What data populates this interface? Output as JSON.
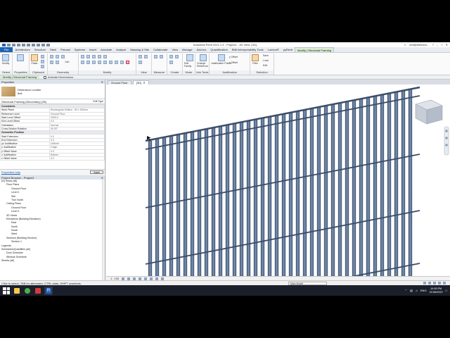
{
  "titlebar": {
    "title": "Autodesk Revit 2021.1.3 - Project1 - 3D View: {3D}",
    "user": "ami@iebiconc...",
    "help": "?"
  },
  "tabs": [
    "File",
    "Architecture",
    "Structure",
    "Steel",
    "Precast",
    "Systems",
    "Insert",
    "Annotate",
    "Analyze",
    "Massing & Site",
    "Collaborate",
    "View",
    "Manage",
    "Add-Ins",
    "Quantification",
    "BIM Interoperability Tools",
    "Lumion®",
    "pyRevit",
    "Modify | Structural Framing"
  ],
  "ribbon": {
    "groups": [
      "Select",
      "Properties",
      "Clipboard",
      "Geometry",
      "Modify",
      "View",
      "Measure",
      "Create",
      "Mode",
      "Join Tools",
      "Justification",
      "Selection"
    ],
    "labels": {
      "modify": "Modify",
      "paste": "Paste",
      "join": "Join",
      "edit_family": "Edit Family",
      "change_reference": "Change Reference",
      "justification_points": "Justification Points",
      "y_offset": "y Offset",
      "z_offset": "z Offset",
      "filter": "Filter",
      "save": "Save",
      "load": "Load",
      "edit": "Edit"
    }
  },
  "optionsbar": {
    "context": "Modify | Structural Framing",
    "checkbox": "Activate Dimensions"
  },
  "properties": {
    "title": "Properties",
    "type_name": "Dimension Lumber",
    "type_size": "8x6",
    "filter": "Structural Framing (Secondary) (35)",
    "edit_type": "Edit Type",
    "rows": [
      {
        "k": "Constraints",
        "v": "",
        "section": true
      },
      {
        "k": "Work Plane",
        "v": "Rectangular Mullion : 50 x 150mm"
      },
      {
        "k": "Reference Level",
        "v": "Ground Floor"
      },
      {
        "k": "Start Level Offset",
        "v": "2000.0"
      },
      {
        "k": "End Level Offset",
        "v": "0.0"
      },
      {
        "k": "Orientation",
        "v": "Normal"
      },
      {
        "k": "Cross-Section Rotation",
        "v": "90.00°"
      },
      {
        "k": "Geometric Position",
        "v": "",
        "section": true
      },
      {
        "k": "Start Extension",
        "v": "0.0"
      },
      {
        "k": "End Extension",
        "v": "0.0"
      },
      {
        "k": "yz Justification",
        "v": "Uniform"
      },
      {
        "k": "y Justification",
        "v": "Origin"
      },
      {
        "k": "y Offset Value",
        "v": "0.0"
      },
      {
        "k": "z Justification",
        "v": "Bottom"
      },
      {
        "k": "z Offset Value",
        "v": "0.0"
      }
    ],
    "help_link": "Properties help",
    "apply": "Apply"
  },
  "browser": {
    "title": "Project Browser - Project1",
    "items": [
      {
        "label": "[O] Views (all)",
        "indent": 0
      },
      {
        "label": "Floor Plans",
        "indent": 1
      },
      {
        "label": "Ground Floor",
        "indent": 2
      },
      {
        "label": "Level 1",
        "indent": 2
      },
      {
        "label": "Site",
        "indent": 2
      },
      {
        "label": "True North",
        "indent": 2
      },
      {
        "label": "Ceiling Plans",
        "indent": 1
      },
      {
        "label": "Ground Floor",
        "indent": 2
      },
      {
        "label": "Level 1",
        "indent": 2
      },
      {
        "label": "3D Views",
        "indent": 1
      },
      {
        "label": "Elevations (Building Elevation)",
        "indent": 1
      },
      {
        "label": "East",
        "indent": 2
      },
      {
        "label": "North",
        "indent": 2
      },
      {
        "label": "South",
        "indent": 2
      },
      {
        "label": "West",
        "indent": 2
      },
      {
        "label": "Sections (Building Section)",
        "indent": 1
      },
      {
        "label": "Section 1",
        "indent": 2
      },
      {
        "label": "Legends",
        "indent": 0
      },
      {
        "label": "Schedules/Quantities (all)",
        "indent": 0
      },
      {
        "label": "Door Schedule",
        "indent": 1
      },
      {
        "label": "Window Schedule",
        "indent": 1
      },
      {
        "label": "Sheets (all)",
        "indent": 0
      }
    ]
  },
  "viewtabs": [
    {
      "label": "Ground Floor",
      "active": false
    },
    {
      "label": "{3D}",
      "active": true
    }
  ],
  "viewbar": {
    "scale": "1 : 100"
  },
  "status": {
    "text": "Click to select, TAB for alternates, CTRL adds, SHIFT unselects.",
    "model": "Main Model"
  },
  "taskbar": {
    "lang": "ENG",
    "time": "10:05 PM",
    "date": "21/06/2022"
  },
  "colors": {
    "accent": "#1e63b5",
    "context_tab": "#d9ecd3",
    "mullion": "#5c7294"
  }
}
